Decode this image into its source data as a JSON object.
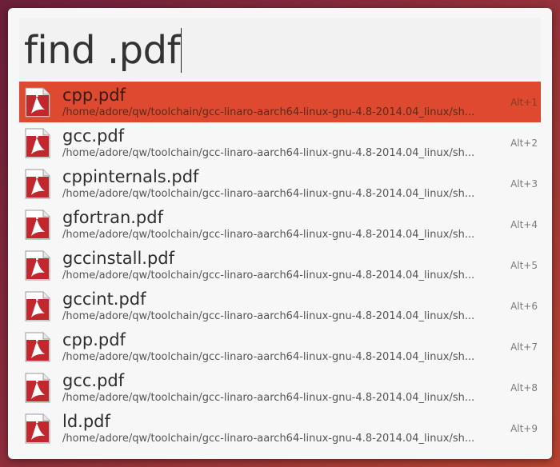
{
  "search": {
    "query": "find .pdf"
  },
  "results": [
    {
      "name": "cpp.pdf",
      "path": "/home/adore/qw/toolchain/gcc-linaro-aarch64-linux-gnu-4.8-2014.04_linux/sh...",
      "shortcut": "Alt+1",
      "selected": true,
      "icon": "pdf-file-icon"
    },
    {
      "name": "gcc.pdf",
      "path": "/home/adore/qw/toolchain/gcc-linaro-aarch64-linux-gnu-4.8-2014.04_linux/sh...",
      "shortcut": "Alt+2",
      "selected": false,
      "icon": "pdf-file-icon"
    },
    {
      "name": "cppinternals.pdf",
      "path": "/home/adore/qw/toolchain/gcc-linaro-aarch64-linux-gnu-4.8-2014.04_linux/sh...",
      "shortcut": "Alt+3",
      "selected": false,
      "icon": "pdf-file-icon"
    },
    {
      "name": "gfortran.pdf",
      "path": "/home/adore/qw/toolchain/gcc-linaro-aarch64-linux-gnu-4.8-2014.04_linux/sh...",
      "shortcut": "Alt+4",
      "selected": false,
      "icon": "pdf-file-icon"
    },
    {
      "name": "gccinstall.pdf",
      "path": "/home/adore/qw/toolchain/gcc-linaro-aarch64-linux-gnu-4.8-2014.04_linux/sh...",
      "shortcut": "Alt+5",
      "selected": false,
      "icon": "pdf-file-icon"
    },
    {
      "name": "gccint.pdf",
      "path": "/home/adore/qw/toolchain/gcc-linaro-aarch64-linux-gnu-4.8-2014.04_linux/sh...",
      "shortcut": "Alt+6",
      "selected": false,
      "icon": "pdf-file-icon"
    },
    {
      "name": "cpp.pdf",
      "path": "/home/adore/qw/toolchain/gcc-linaro-aarch64-linux-gnu-4.8-2014.04_linux/sh...",
      "shortcut": "Alt+7",
      "selected": false,
      "icon": "pdf-file-icon"
    },
    {
      "name": "gcc.pdf",
      "path": "/home/adore/qw/toolchain/gcc-linaro-aarch64-linux-gnu-4.8-2014.04_linux/sh...",
      "shortcut": "Alt+8",
      "selected": false,
      "icon": "pdf-file-icon"
    },
    {
      "name": "ld.pdf",
      "path": "/home/adore/qw/toolchain/gcc-linaro-aarch64-linux-gnu-4.8-2014.04_linux/sh...",
      "shortcut": "Alt+9",
      "selected": false,
      "icon": "pdf-file-icon"
    }
  ],
  "colors": {
    "selected_row": "#de4a2f",
    "pdf_icon_red": "#c1272d",
    "window_bg": "#f7f7f7"
  }
}
